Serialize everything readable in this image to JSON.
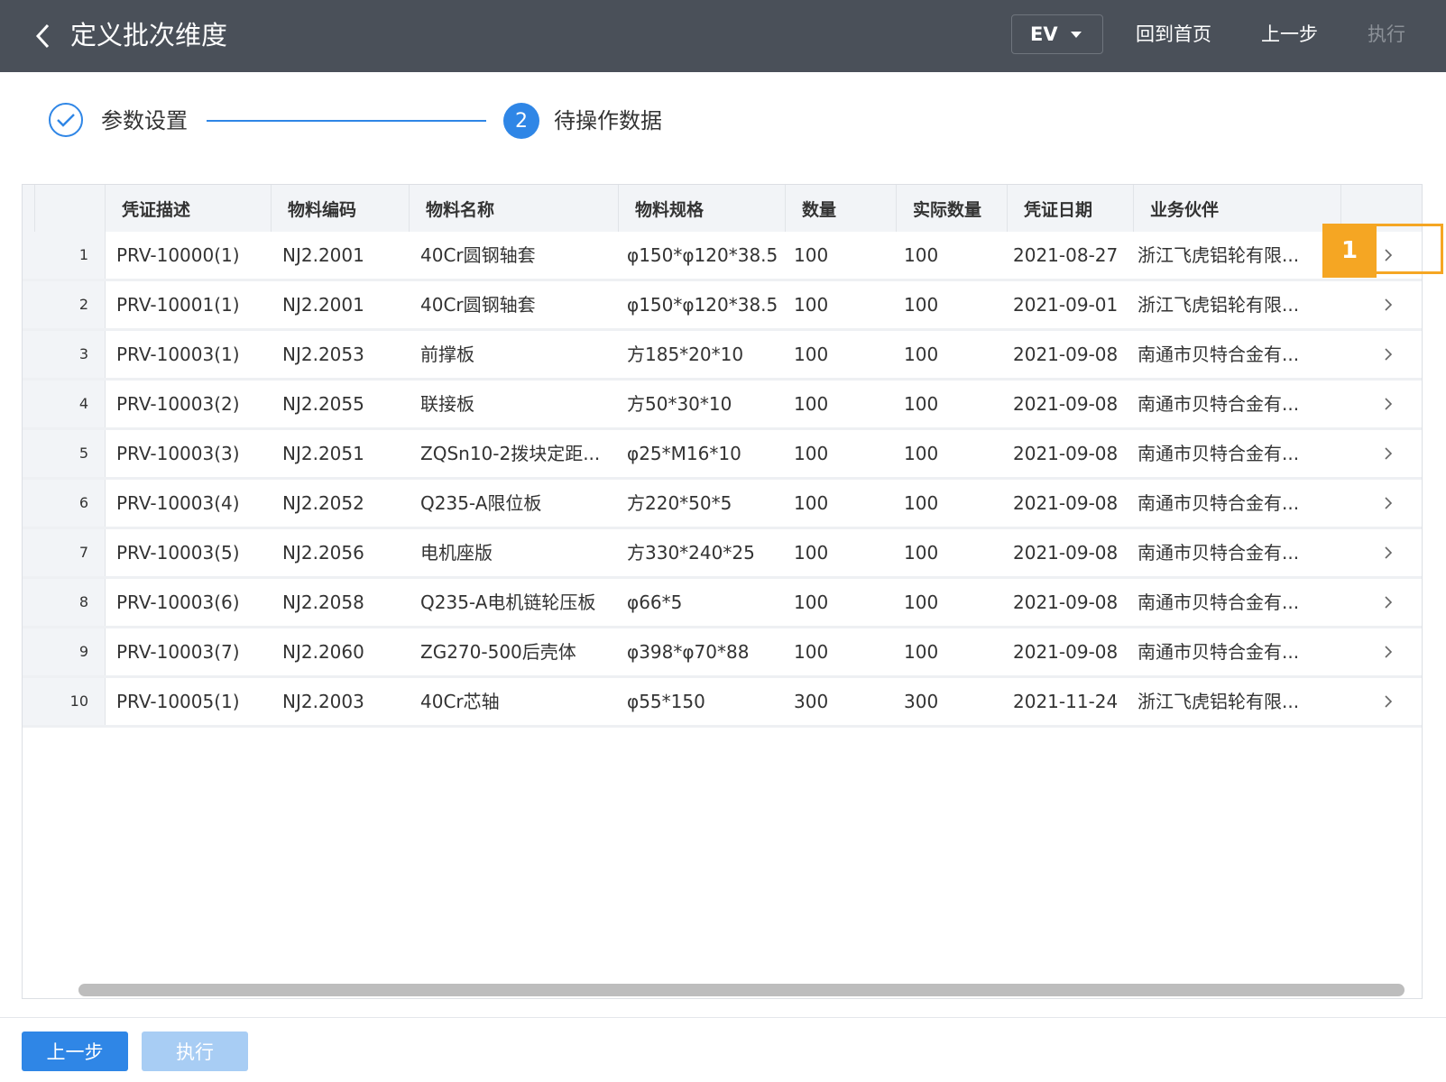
{
  "header": {
    "title": "定义批次维度",
    "version_select": "EV",
    "buttons": {
      "home": "回到首页",
      "prev": "上一步",
      "execute": "执行"
    }
  },
  "steps": [
    {
      "label": "参数设置",
      "status": "done"
    },
    {
      "number": "2",
      "label": "待操作数据",
      "status": "active"
    }
  ],
  "table": {
    "columns": [
      "凭证描述",
      "物料编码",
      "物料名称",
      "物料规格",
      "数量",
      "实际数量",
      "凭证日期",
      "业务伙伴"
    ],
    "rows": [
      {
        "idx": "1",
        "desc": "PRV-10000(1)",
        "code": "NJ2.2001",
        "name": "40Cr圆钢轴套",
        "spec": "φ150*φ120*38.5",
        "qty": "100",
        "actual": "100",
        "date": "2021-08-27",
        "partner": "浙江飞虎铝轮有限..."
      },
      {
        "idx": "2",
        "desc": "PRV-10001(1)",
        "code": "NJ2.2001",
        "name": "40Cr圆钢轴套",
        "spec": "φ150*φ120*38.5",
        "qty": "100",
        "actual": "100",
        "date": "2021-09-01",
        "partner": "浙江飞虎铝轮有限..."
      },
      {
        "idx": "3",
        "desc": "PRV-10003(1)",
        "code": "NJ2.2053",
        "name": "前撑板",
        "spec": "方185*20*10",
        "qty": "100",
        "actual": "100",
        "date": "2021-09-08",
        "partner": "南通市贝特合金有..."
      },
      {
        "idx": "4",
        "desc": "PRV-10003(2)",
        "code": "NJ2.2055",
        "name": "联接板",
        "spec": "方50*30*10",
        "qty": "100",
        "actual": "100",
        "date": "2021-09-08",
        "partner": "南通市贝特合金有..."
      },
      {
        "idx": "5",
        "desc": "PRV-10003(3)",
        "code": "NJ2.2051",
        "name": "ZQSn10-2拨块定距...",
        "spec": "φ25*M16*10",
        "qty": "100",
        "actual": "100",
        "date": "2021-09-08",
        "partner": "南通市贝特合金有..."
      },
      {
        "idx": "6",
        "desc": "PRV-10003(4)",
        "code": "NJ2.2052",
        "name": "Q235-A限位板",
        "spec": "方220*50*5",
        "qty": "100",
        "actual": "100",
        "date": "2021-09-08",
        "partner": "南通市贝特合金有..."
      },
      {
        "idx": "7",
        "desc": "PRV-10003(5)",
        "code": "NJ2.2056",
        "name": "电机座版",
        "spec": "方330*240*25",
        "qty": "100",
        "actual": "100",
        "date": "2021-09-08",
        "partner": "南通市贝特合金有..."
      },
      {
        "idx": "8",
        "desc": "PRV-10003(6)",
        "code": "NJ2.2058",
        "name": "Q235-A电机链轮压板",
        "spec": "φ66*5",
        "qty": "100",
        "actual": "100",
        "date": "2021-09-08",
        "partner": "南通市贝特合金有..."
      },
      {
        "idx": "9",
        "desc": "PRV-10003(7)",
        "code": "NJ2.2060",
        "name": "ZG270-500后壳体",
        "spec": "φ398*φ70*88",
        "qty": "100",
        "actual": "100",
        "date": "2021-09-08",
        "partner": "南通市贝特合金有..."
      },
      {
        "idx": "10",
        "desc": "PRV-10005(1)",
        "code": "NJ2.2003",
        "name": "40Cr芯轴",
        "spec": "φ55*150",
        "qty": "300",
        "actual": "300",
        "date": "2021-11-24",
        "partner": "浙江飞虎铝轮有限..."
      }
    ]
  },
  "callout": {
    "label": "1"
  },
  "footer": {
    "prev": "上一步",
    "execute": "执行"
  },
  "colors": {
    "header_bg": "#4a5059",
    "accent": "#2f86e6",
    "callout": "#f5a623",
    "disabled_button": "#a8cdf4"
  },
  "icons": [
    "chevron-left-icon",
    "caret-down-icon",
    "check-icon",
    "chevron-right-icon"
  ]
}
